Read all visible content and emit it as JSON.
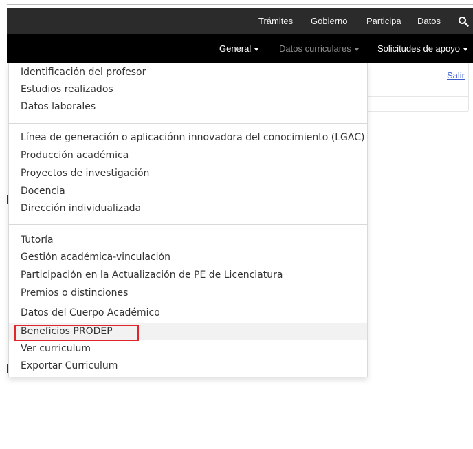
{
  "gov_bar": {
    "links": [
      "Trámites",
      "Gobierno",
      "Participa",
      "Datos"
    ]
  },
  "main_nav": {
    "items": [
      "General",
      "Datos curriculares",
      "Solicitudes de apoyo"
    ]
  },
  "background": {
    "salir_label": "Salir"
  },
  "dropdown": {
    "groups": [
      [
        "Identificación del profesor",
        "Estudios realizados",
        "Datos laborales"
      ],
      [
        "Línea de generación o aplicaciónn innovadora del conocimiento (LGAC)",
        "Producción académica",
        "Proyectos de investigación",
        "Docencia",
        "Dirección individualizada"
      ],
      [
        "Tutoría",
        "Gestión académica-vinculación",
        "Participación en la Actualización de PE de Licenciatura",
        "Premios o distinciones",
        "Datos del Cuerpo Académico",
        "Beneficios PRODEP",
        "Ver curriculum",
        "Exportar Curriculum"
      ]
    ],
    "highlighted_item": "Beneficios PRODEP"
  },
  "colors": {
    "gov_bar_bg": "#2b2b2b",
    "nav_bg": "#000000",
    "nav_active_text": "#8c8c8c",
    "highlight_border": "#e0262c",
    "link": "#3a5fcd"
  }
}
